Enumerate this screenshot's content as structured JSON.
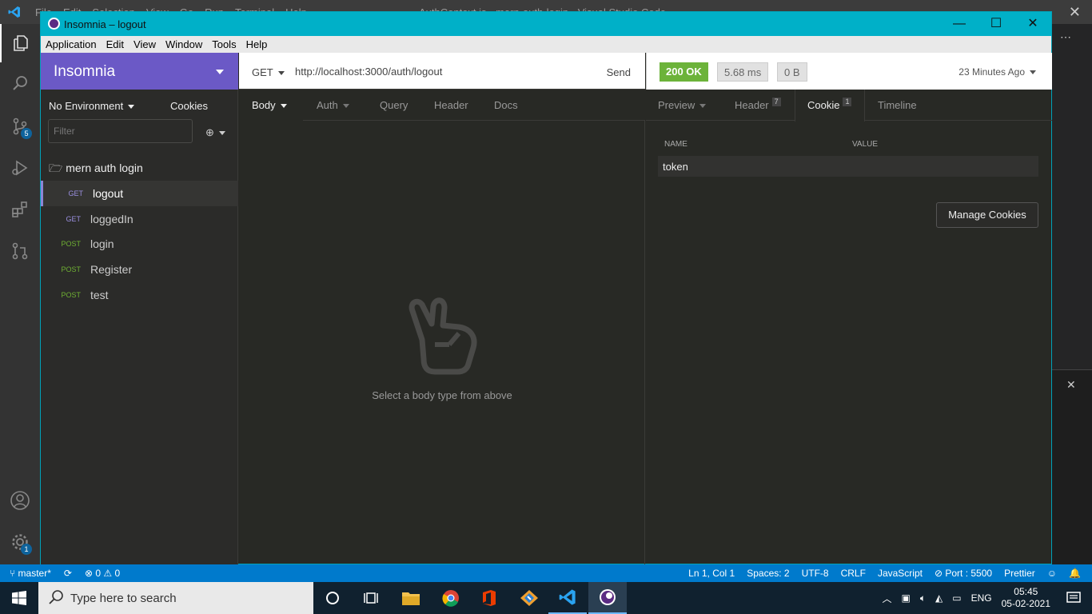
{
  "vscode": {
    "menu": [
      "File",
      "Edit",
      "Selection",
      "View",
      "Go",
      "Run",
      "Terminal",
      "Help"
    ],
    "window_title": "AuthContext.js - mern-auth-login - Visual Studio Code",
    "source_control_badge": "5",
    "settings_badge": "1"
  },
  "statusbar": {
    "branch": "master*",
    "problems_errors": "0",
    "problems_warnings": "0",
    "cursor": "Ln 1, Col 1",
    "spaces": "Spaces: 2",
    "encoding": "UTF-8",
    "eol": "CRLF",
    "language": "JavaScript",
    "port": "Port : 5500",
    "formatter": "Prettier"
  },
  "insomnia": {
    "window_title": "Insomnia – logout",
    "menu": [
      "Application",
      "Edit",
      "View",
      "Window",
      "Tools",
      "Help"
    ],
    "workspace": "Insomnia",
    "environment": "No Environment",
    "cookies_label": "Cookies",
    "filter_placeholder": "Filter",
    "folder": "mern auth login",
    "requests": [
      {
        "method": "GET",
        "name": "logout"
      },
      {
        "method": "GET",
        "name": "loggedIn"
      },
      {
        "method": "POST",
        "name": "login"
      },
      {
        "method": "POST",
        "name": "Register"
      },
      {
        "method": "POST",
        "name": "test"
      }
    ],
    "request": {
      "method": "GET",
      "url": "http://localhost:3000/auth/logout",
      "send_label": "Send",
      "tabs": [
        "Body",
        "Auth",
        "Query",
        "Header",
        "Docs"
      ],
      "body_message": "Select a body type from above"
    },
    "response": {
      "status": "200 OK",
      "time": "5.68 ms",
      "size": "0 B",
      "age": "23 Minutes Ago",
      "tabs": {
        "preview": "Preview",
        "header": "Header",
        "header_count": "7",
        "cookie": "Cookie",
        "cookie_count": "1",
        "timeline": "Timeline"
      },
      "cookie_columns": [
        "NAME",
        "VALUE"
      ],
      "cookie_name": "token",
      "manage_label": "Manage Cookies"
    }
  },
  "taskbar": {
    "search_placeholder": "Type here to search",
    "lang": "ENG",
    "time": "05:45",
    "date": "05-02-2021"
  },
  "colors": {
    "insomnia_purple": "#6b59c6",
    "title_cyan": "#00b0c8",
    "status_green": "#6cb33a",
    "vscode_blue": "#007acc"
  }
}
